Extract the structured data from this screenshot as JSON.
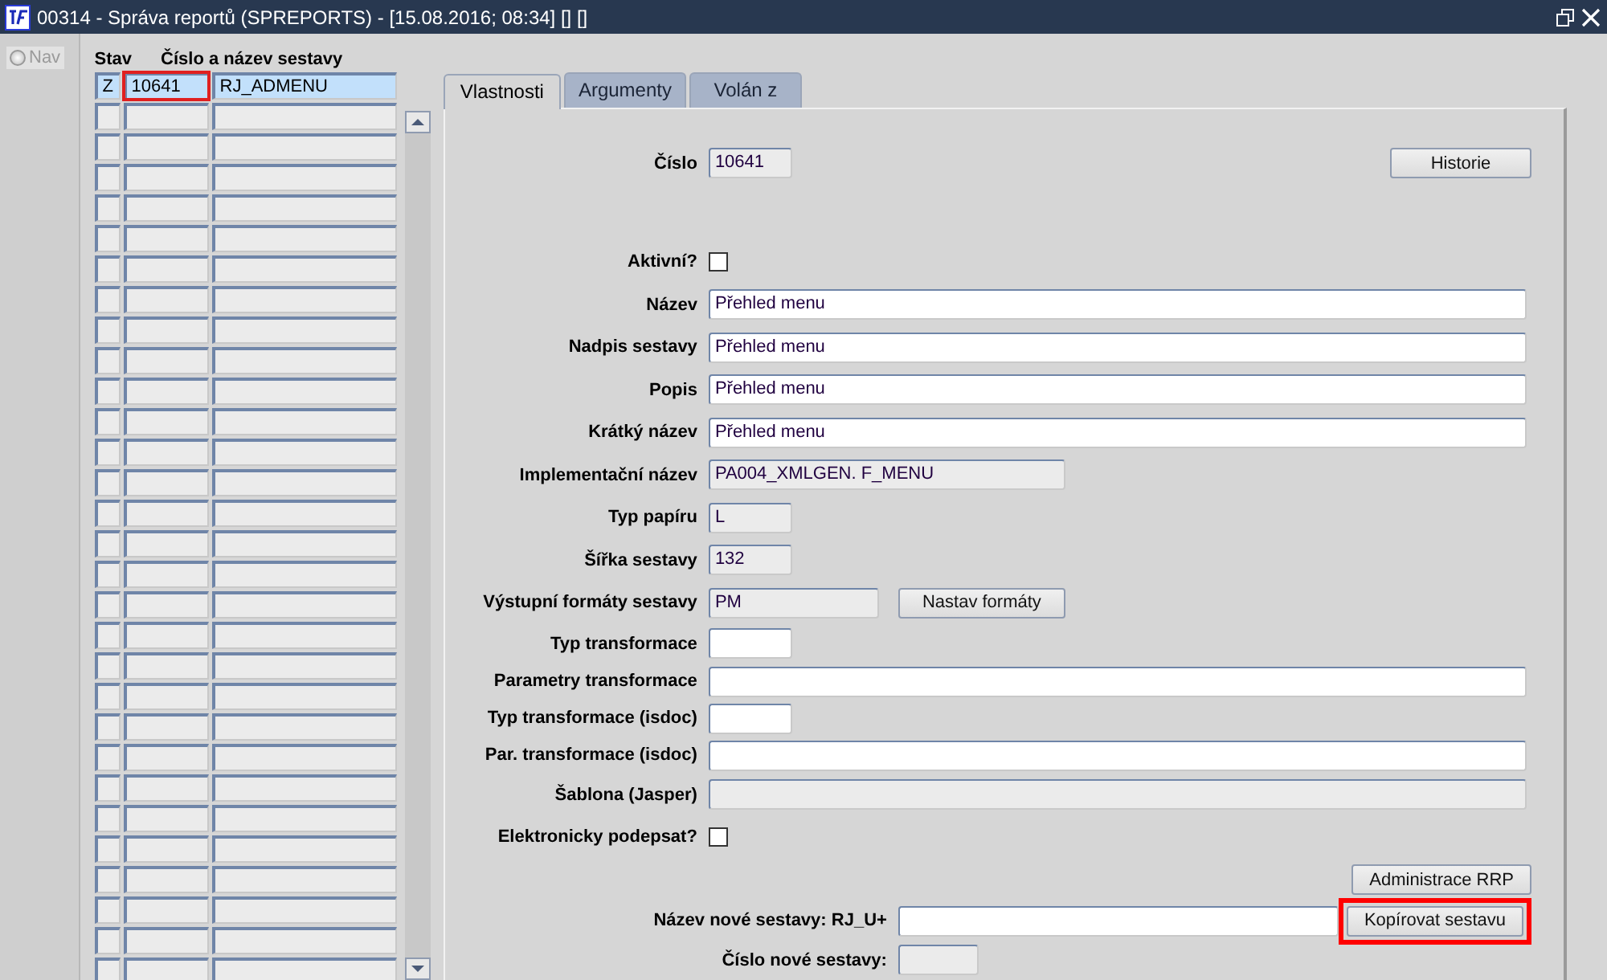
{
  "window": {
    "title": "00314 - Správa reportů (SPREPORTS) - [15.08.2016; 08:34] [] []"
  },
  "nav": {
    "label": "Nav",
    "selected": false,
    "disabled": true
  },
  "grid": {
    "columns": [
      "Stav",
      "Číslo a název sestavy"
    ],
    "rows": [
      {
        "stav": "Z",
        "cislo": "10641",
        "nazev": "RJ_ADMENU",
        "selected": true,
        "focused": true
      },
      {
        "selected": false,
        "focused": false
      },
      {
        "selected": false,
        "focused": false
      },
      {
        "selected": false,
        "focused": false
      },
      {
        "selected": false,
        "focused": false
      },
      {
        "selected": false,
        "focused": false
      },
      {
        "selected": false,
        "focused": false
      },
      {
        "selected": false,
        "focused": false
      },
      {
        "selected": false,
        "focused": false
      },
      {
        "selected": false,
        "focused": false
      },
      {
        "selected": false,
        "focused": false
      },
      {
        "selected": false,
        "focused": false
      },
      {
        "selected": false,
        "focused": false
      },
      {
        "selected": false,
        "focused": false
      },
      {
        "selected": false,
        "focused": false
      },
      {
        "selected": false,
        "focused": false
      },
      {
        "selected": false,
        "focused": false
      },
      {
        "selected": false,
        "focused": false
      },
      {
        "selected": false,
        "focused": false
      },
      {
        "selected": false,
        "focused": false
      },
      {
        "selected": false,
        "focused": false
      },
      {
        "selected": false,
        "focused": false
      },
      {
        "selected": false,
        "focused": false
      },
      {
        "selected": false,
        "focused": false
      },
      {
        "selected": false,
        "focused": false
      },
      {
        "selected": false,
        "focused": false
      },
      {
        "selected": false,
        "focused": false
      },
      {
        "selected": false,
        "focused": false
      },
      {
        "selected": false,
        "focused": false
      },
      {
        "selected": false,
        "focused": false
      }
    ]
  },
  "tabs": [
    {
      "label": "Vlastnosti",
      "selected": true
    },
    {
      "label": "Argumenty",
      "selected": false
    },
    {
      "label": "Volán z",
      "selected": false
    }
  ],
  "header_field": {
    "label": "Číslo",
    "value": "10641",
    "readonly": true,
    "button": "Historie"
  },
  "fields": [
    {
      "kind": "checkbox",
      "label": "Aktivní?",
      "checked": false
    },
    {
      "kind": "text",
      "label": "Název",
      "value": "Přehled menu",
      "readonly": false
    },
    {
      "kind": "text",
      "label": "Nadpis sestavy",
      "value": "Přehled menu",
      "readonly": false
    },
    {
      "kind": "text",
      "label": "Popis",
      "value": "Přehled menu",
      "readonly": false
    },
    {
      "kind": "text",
      "label": "Krátký název",
      "value": "Přehled menu",
      "readonly": false
    },
    {
      "kind": "text",
      "label": "Implementační název",
      "value": "PA004_XMLGEN. F_MENU",
      "readonly": true
    },
    {
      "kind": "text",
      "label": "Typ papíru",
      "value": "L",
      "readonly": true
    },
    {
      "kind": "text",
      "label": "Šířka sestavy",
      "value": "132",
      "readonly": true
    },
    {
      "kind": "text",
      "label": "Výstupní formáty sestavy",
      "value": "PM",
      "readonly": true,
      "button": "Nastav formáty"
    },
    {
      "kind": "text",
      "label": "Typ transformace",
      "readonly": false
    },
    {
      "kind": "text",
      "label": "Parametry transformace",
      "readonly": false
    },
    {
      "kind": "text",
      "label": "Typ transformace (isdoc)",
      "readonly": false
    },
    {
      "kind": "text",
      "label": "Par. transformace (isdoc)",
      "readonly": false
    },
    {
      "kind": "text",
      "label": "Šablona (Jasper)",
      "readonly": true
    },
    {
      "kind": "checkbox",
      "label": "Elektronicky podepsat?",
      "checked": false
    }
  ],
  "admin_button": "Administrace RRP",
  "copy": {
    "name_label": "Název nové sestavy: RJ_U+",
    "button": "Kopírovat sestavu",
    "button_highlighted": true,
    "number_label": "Číslo nové sestavy:"
  }
}
